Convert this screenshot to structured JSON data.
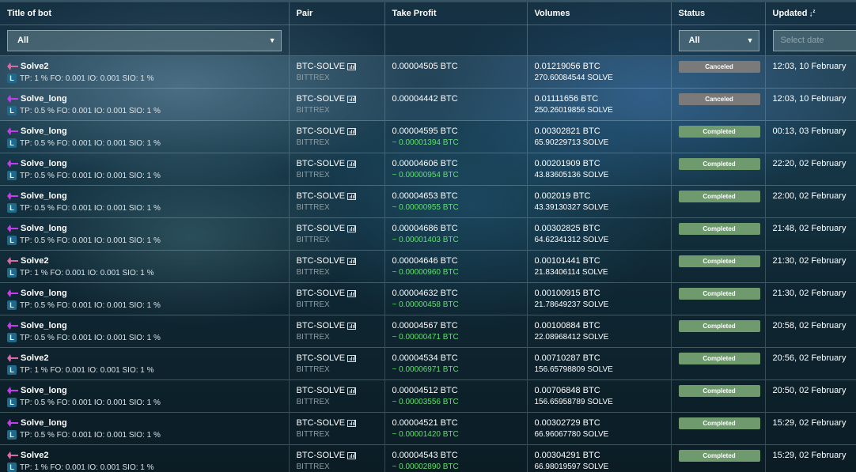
{
  "colors": {
    "canceled": "#7a7a7a",
    "completed": "#6e9a6e",
    "profit": "#5fe06a",
    "bot_icon_solve2": "#d86aa8",
    "bot_icon_solve_long": "#c33ee8",
    "badge_l": "#1f6a8a"
  },
  "table": {
    "headers": {
      "title": "Title of bot",
      "pair": "Pair",
      "take_profit": "Take Profit",
      "volumes": "Volumes",
      "status": "Status",
      "updated": "Updated",
      "updated_sort_icon": "sort-alpha-desc-icon"
    },
    "filters": {
      "title_select": "All",
      "status_select": "All",
      "date_placeholder": "Select date"
    },
    "rows": [
      {
        "bot": "Solve2",
        "bot_type": "solve2",
        "badge": "L",
        "params": "TP: 1 % FO: 0.001 IO: 0.001 SIO: 1 %",
        "pair": "BTC-SOLVE",
        "exchange": "BITTREX",
        "tp": "0.00004505 BTC",
        "profit": "",
        "vol_btc": "0.01219056 BTC",
        "vol_solve": "270.60084544 SOLVE",
        "status": "Canceled",
        "updated": "12:03, 10 February"
      },
      {
        "bot": "Solve_long",
        "bot_type": "long",
        "badge": "L",
        "params": "TP: 0.5 % FO: 0.001 IO: 0.001 SIO: 1 %",
        "pair": "BTC-SOLVE",
        "exchange": "BITTREX",
        "tp": "0.00004442 BTC",
        "profit": "",
        "vol_btc": "0.01111656 BTC",
        "vol_solve": "250.26019856 SOLVE",
        "status": "Canceled",
        "updated": "12:03, 10 February"
      },
      {
        "bot": "Solve_long",
        "bot_type": "long",
        "badge": "L",
        "params": "TP: 0.5 % FO: 0.001 IO: 0.001 SIO: 1 %",
        "pair": "BTC-SOLVE",
        "exchange": "BITTREX",
        "tp": "0.00004595 BTC",
        "profit": "~ 0.00001394 BTC",
        "vol_btc": "0.00302821 BTC",
        "vol_solve": "65.90229713 SOLVE",
        "status": "Completed",
        "updated": "00:13, 03 February"
      },
      {
        "bot": "Solve_long",
        "bot_type": "long",
        "badge": "L",
        "params": "TP: 0.5 % FO: 0.001 IO: 0.001 SIO: 1 %",
        "pair": "BTC-SOLVE",
        "exchange": "BITTREX",
        "tp": "0.00004606 BTC",
        "profit": "~ 0.00000954 BTC",
        "vol_btc": "0.00201909 BTC",
        "vol_solve": "43.83605136 SOLVE",
        "status": "Completed",
        "updated": "22:20, 02 February"
      },
      {
        "bot": "Solve_long",
        "bot_type": "long",
        "badge": "L",
        "params": "TP: 0.5 % FO: 0.001 IO: 0.001 SIO: 1 %",
        "pair": "BTC-SOLVE",
        "exchange": "BITTREX",
        "tp": "0.00004653 BTC",
        "profit": "~ 0.00000955 BTC",
        "vol_btc": "0.002019 BTC",
        "vol_solve": "43.39130327 SOLVE",
        "status": "Completed",
        "updated": "22:00, 02 February"
      },
      {
        "bot": "Solve_long",
        "bot_type": "long",
        "badge": "L",
        "params": "TP: 0.5 % FO: 0.001 IO: 0.001 SIO: 1 %",
        "pair": "BTC-SOLVE",
        "exchange": "BITTREX",
        "tp": "0.00004686 BTC",
        "profit": "~ 0.00001403 BTC",
        "vol_btc": "0.00302825 BTC",
        "vol_solve": "64.62341312 SOLVE",
        "status": "Completed",
        "updated": "21:48, 02 February"
      },
      {
        "bot": "Solve2",
        "bot_type": "solve2",
        "badge": "L",
        "params": "TP: 1 % FO: 0.001 IO: 0.001 SIO: 1 %",
        "pair": "BTC-SOLVE",
        "exchange": "BITTREX",
        "tp": "0.00004646 BTC",
        "profit": "~ 0.00000960 BTC",
        "vol_btc": "0.00101441 BTC",
        "vol_solve": "21.83406114 SOLVE",
        "status": "Completed",
        "updated": "21:30, 02 February"
      },
      {
        "bot": "Solve_long",
        "bot_type": "long",
        "badge": "L",
        "params": "TP: 0.5 % FO: 0.001 IO: 0.001 SIO: 1 %",
        "pair": "BTC-SOLVE",
        "exchange": "BITTREX",
        "tp": "0.00004632 BTC",
        "profit": "~ 0.00000458 BTC",
        "vol_btc": "0.00100915 BTC",
        "vol_solve": "21.78649237 SOLVE",
        "status": "Completed",
        "updated": "21:30, 02 February"
      },
      {
        "bot": "Solve_long",
        "bot_type": "long",
        "badge": "L",
        "params": "TP: 0.5 % FO: 0.001 IO: 0.001 SIO: 1 %",
        "pair": "BTC-SOLVE",
        "exchange": "BITTREX",
        "tp": "0.00004567 BTC",
        "profit": "~ 0.00000471 BTC",
        "vol_btc": "0.00100884 BTC",
        "vol_solve": "22.08968412 SOLVE",
        "status": "Completed",
        "updated": "20:58, 02 February"
      },
      {
        "bot": "Solve2",
        "bot_type": "solve2",
        "badge": "L",
        "params": "TP: 1 % FO: 0.001 IO: 0.001 SIO: 1 %",
        "pair": "BTC-SOLVE",
        "exchange": "BITTREX",
        "tp": "0.00004534 BTC",
        "profit": "~ 0.00006971 BTC",
        "vol_btc": "0.00710287 BTC",
        "vol_solve": "156.65798809 SOLVE",
        "status": "Completed",
        "updated": "20:56, 02 February"
      },
      {
        "bot": "Solve_long",
        "bot_type": "long",
        "badge": "L",
        "params": "TP: 0.5 % FO: 0.001 IO: 0.001 SIO: 1 %",
        "pair": "BTC-SOLVE",
        "exchange": "BITTREX",
        "tp": "0.00004512 BTC",
        "profit": "~ 0.00003556 BTC",
        "vol_btc": "0.00706848 BTC",
        "vol_solve": "156.65958789 SOLVE",
        "status": "Completed",
        "updated": "20:50, 02 February"
      },
      {
        "bot": "Solve_long",
        "bot_type": "long",
        "badge": "L",
        "params": "TP: 0.5 % FO: 0.001 IO: 0.001 SIO: 1 %",
        "pair": "BTC-SOLVE",
        "exchange": "BITTREX",
        "tp": "0.00004521 BTC",
        "profit": "~ 0.00001420 BTC",
        "vol_btc": "0.00302729 BTC",
        "vol_solve": "66.96067780 SOLVE",
        "status": "Completed",
        "updated": "15:29, 02 February"
      },
      {
        "bot": "Solve2",
        "bot_type": "solve2",
        "badge": "L",
        "params": "TP: 1 % FO: 0.001 IO: 0.001 SIO: 1 %",
        "pair": "BTC-SOLVE",
        "exchange": "BITTREX",
        "tp": "0.00004543 BTC",
        "profit": "~ 0.00002890 BTC",
        "vol_btc": "0.00304291 BTC",
        "vol_solve": "66.98019597 SOLVE",
        "status": "Completed",
        "updated": "15:29, 02 February"
      }
    ]
  }
}
